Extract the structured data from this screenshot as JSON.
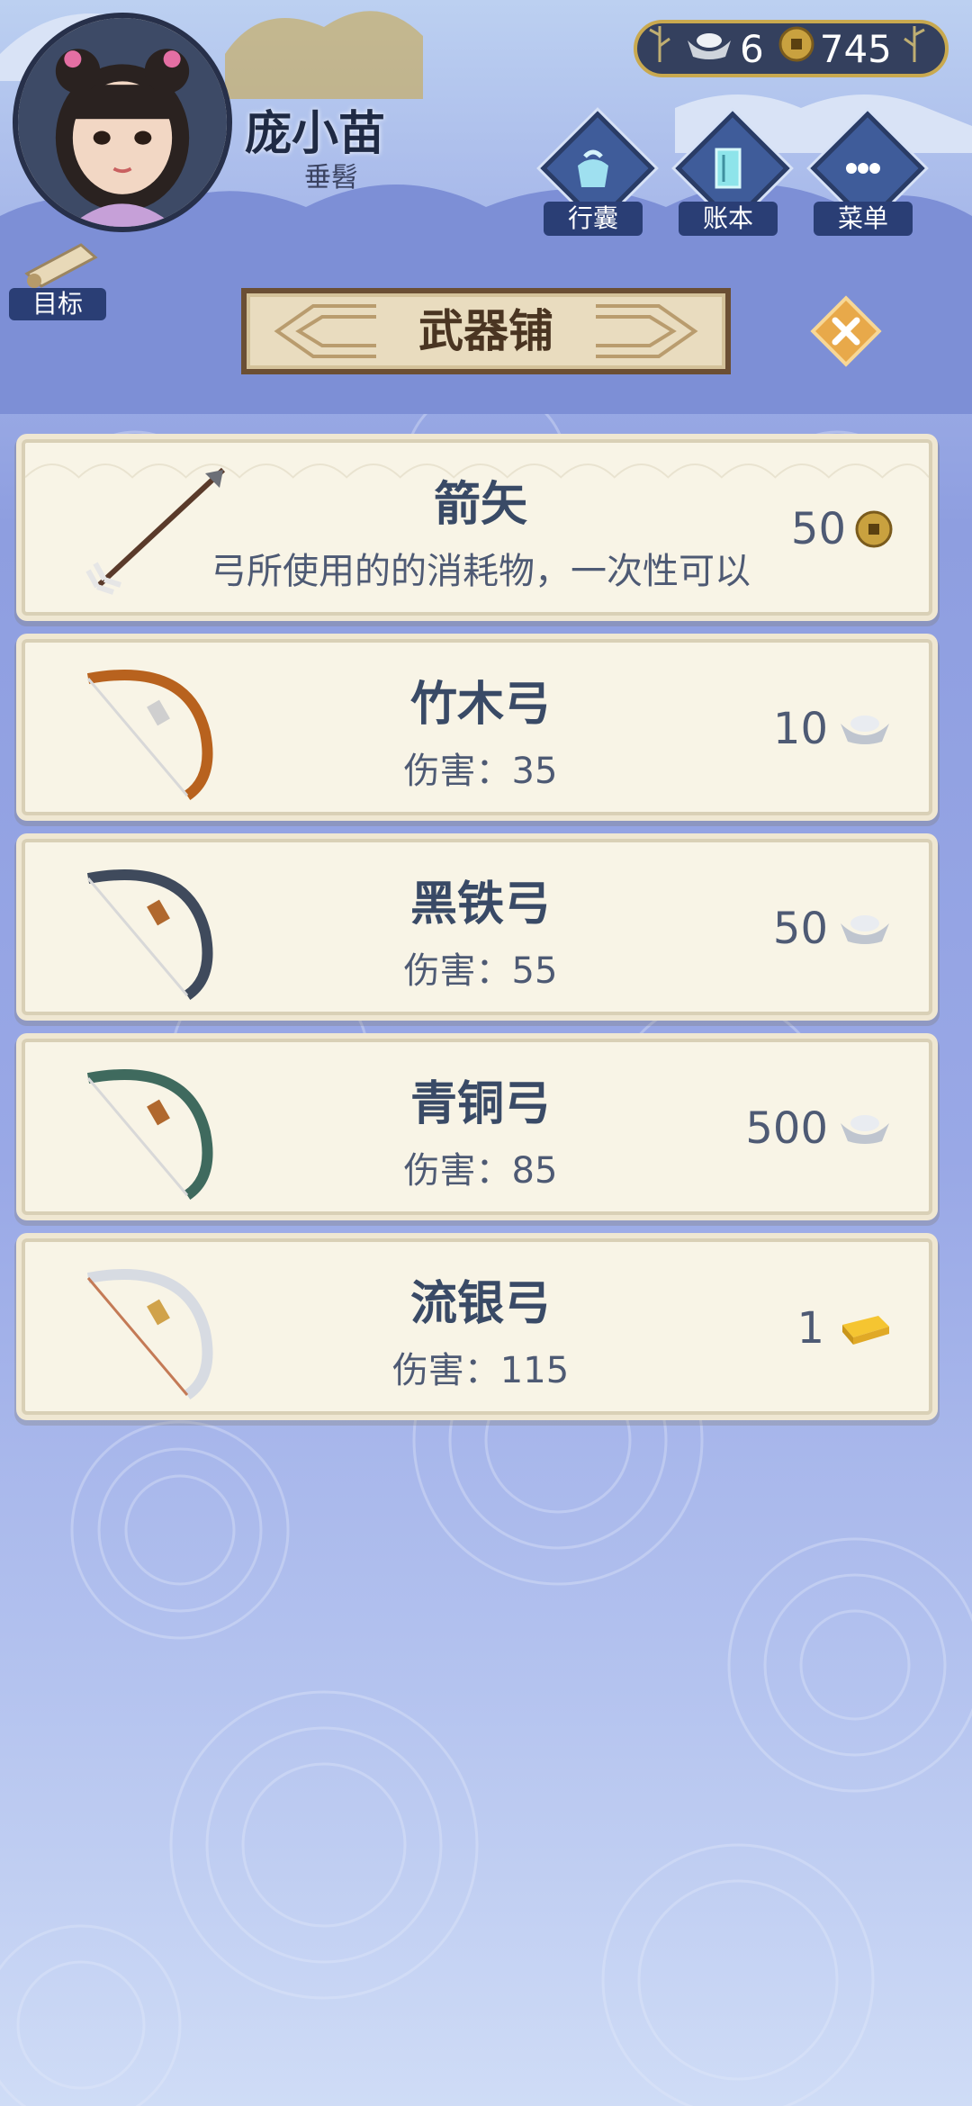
{
  "player": {
    "name": "庞小苗",
    "title": "垂髫"
  },
  "currency": {
    "silver": "6",
    "copper": "745"
  },
  "nav": {
    "bag_label": "行囊",
    "ledger_label": "账本",
    "menu_label": "菜单",
    "goal_label": "目标"
  },
  "shop": {
    "title": "武器铺"
  },
  "items": [
    {
      "name": "箭矢",
      "desc": "弓所使用的的消耗物，一次性可以",
      "price": "50",
      "currency": "copper-coin-icon"
    },
    {
      "name": "竹木弓",
      "desc": "伤害：35",
      "price": "10",
      "currency": "silver-ingot-icon"
    },
    {
      "name": "黑铁弓",
      "desc": "伤害：55",
      "price": "50",
      "currency": "silver-ingot-icon"
    },
    {
      "name": "青铜弓",
      "desc": "伤害：85",
      "price": "500",
      "currency": "silver-ingot-icon"
    },
    {
      "name": "流银弓",
      "desc": "伤害：115",
      "price": "1",
      "currency": "gold-bar-icon"
    }
  ],
  "colors": {
    "accent_dark": "#394a66",
    "card_bg": "#f8f4e6",
    "banner_border": "#6b4f34"
  }
}
